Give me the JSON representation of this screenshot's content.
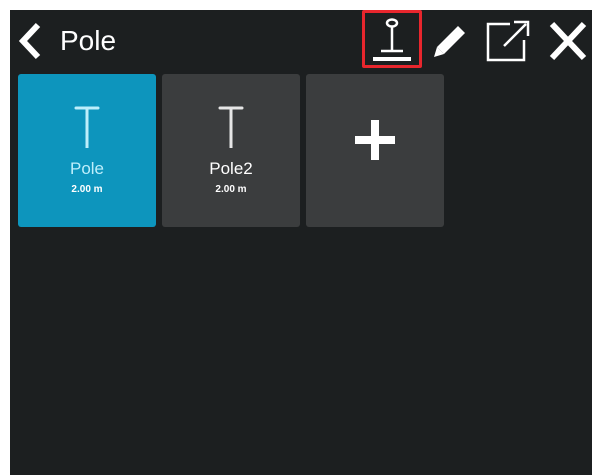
{
  "header": {
    "title": "Pole",
    "back_icon": "chevron-left-icon",
    "tools": [
      {
        "name": "pole-height-tool",
        "icon": "pole-measure-icon",
        "highlighted": true,
        "highlight_color": "#e8262d"
      },
      {
        "name": "edit-tool",
        "icon": "pencil-icon"
      },
      {
        "name": "export-tool",
        "icon": "external-link-icon"
      },
      {
        "name": "close-tool",
        "icon": "close-icon"
      }
    ]
  },
  "poles": [
    {
      "name": "Pole",
      "height": "2.00 m",
      "selected": true,
      "icon": "pole-icon"
    },
    {
      "name": "Pole2",
      "height": "2.00 m",
      "selected": false,
      "icon": "pole-icon"
    }
  ],
  "add_tile": {
    "icon": "plus-icon"
  },
  "colors": {
    "background": "#1c1f20",
    "tile_selected": "#0d95bd",
    "tile_normal": "#3b3d3e",
    "highlight": "#e8262d"
  }
}
